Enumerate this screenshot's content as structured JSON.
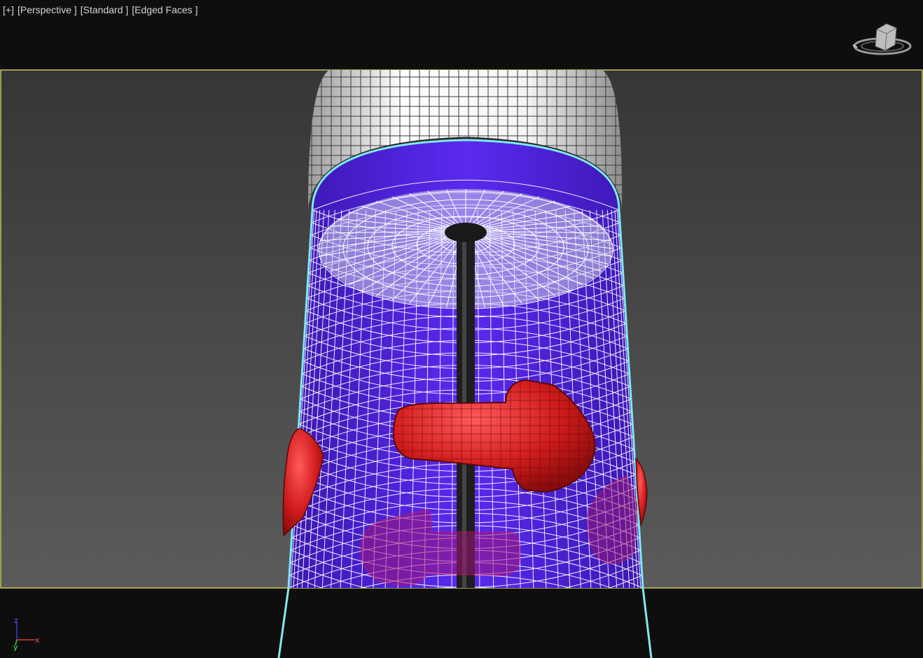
{
  "viewport": {
    "labels": {
      "plus": "[+]",
      "view": "[Perspective ]",
      "shading": "[Standard ]",
      "display": "[Edged Faces ]"
    },
    "colors": {
      "background": "#0e0e0e",
      "safe_frame_border": "#c8c55a",
      "safe_frame_top": "#383838",
      "safe_frame_bottom": "#5a5a5a",
      "cylinder_fill": "#4f1fd8",
      "cylinder_outline": "#7ee9f2",
      "wireframe": "#ffffff",
      "cap_fill": "#f2f2f2",
      "red_object": "#c9181a",
      "rod": "#222222"
    },
    "scene_objects": [
      "glass-cylinder",
      "white-cap",
      "center-rod",
      "red-handle-front",
      "red-handle-left",
      "red-handle-right",
      "red-handle-back"
    ]
  },
  "axis_tripod": {
    "x": "x",
    "y": "y",
    "z": "z"
  },
  "viewcube_icon": "viewcube-icon"
}
